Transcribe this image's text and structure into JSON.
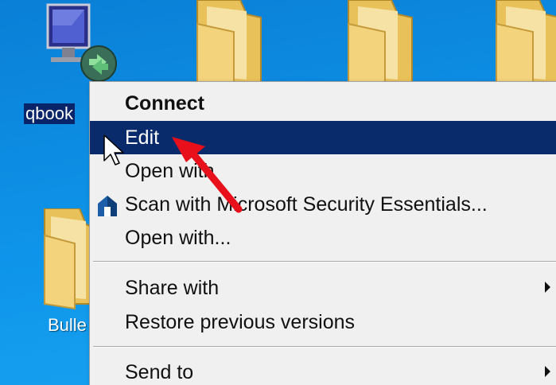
{
  "desktop": {
    "icons": [
      {
        "name": "qbook",
        "label": "qbook"
      },
      {
        "name": "folder",
        "label": "Bulle"
      }
    ]
  },
  "context_menu": {
    "items": [
      {
        "label": "Connect",
        "bold": true
      },
      {
        "label": "Edit",
        "highlighted": true
      },
      {
        "label": "Open with"
      },
      {
        "label": "Scan with Microsoft Security Essentials...",
        "icon": "security-essentials-icon"
      },
      {
        "label": "Open with..."
      },
      {
        "label": "Share with",
        "submenu": true
      },
      {
        "label": "Restore previous versions"
      },
      {
        "label": "Send to",
        "submenu": true
      }
    ]
  },
  "colors": {
    "desktop": "#0e95ea",
    "menu_background": "#f0f0f0",
    "highlight": "#0a2b6b",
    "annotation_arrow": "#e8101a"
  }
}
